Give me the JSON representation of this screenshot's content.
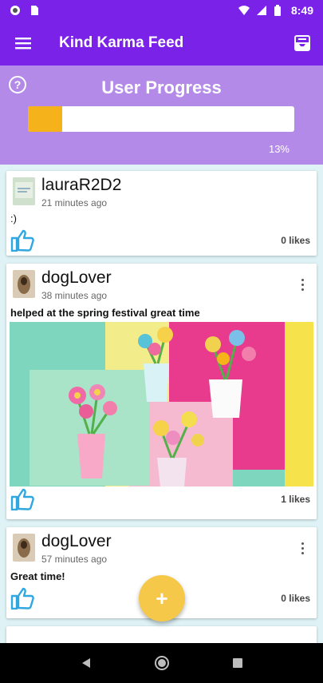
{
  "status_bar": {
    "time": "8:49"
  },
  "app_bar": {
    "title": "Kind Karma Feed"
  },
  "progress": {
    "title": "User Progress",
    "percent_text": "13%",
    "fraction": 0.13,
    "fill_color": "#f6b21a"
  },
  "posts": [
    {
      "username": "lauraR2D2",
      "time": "21 minutes ago",
      "text": ":)",
      "likes": "0 likes",
      "has_menu": false
    },
    {
      "username": "dogLover",
      "time": "38 minutes ago",
      "text": "helped at the spring festival great time",
      "likes": "1 likes",
      "has_menu": true
    },
    {
      "username": "dogLover",
      "time": "57 minutes ago",
      "text": "Great time!",
      "likes": "0 likes",
      "has_menu": true
    }
  ],
  "fab": {
    "label": "+"
  },
  "colors": {
    "primary": "#7a22e8",
    "progress_bg": "#b48ae8",
    "like_icon": "#2fa7e0",
    "fab": "#f5c84a"
  }
}
